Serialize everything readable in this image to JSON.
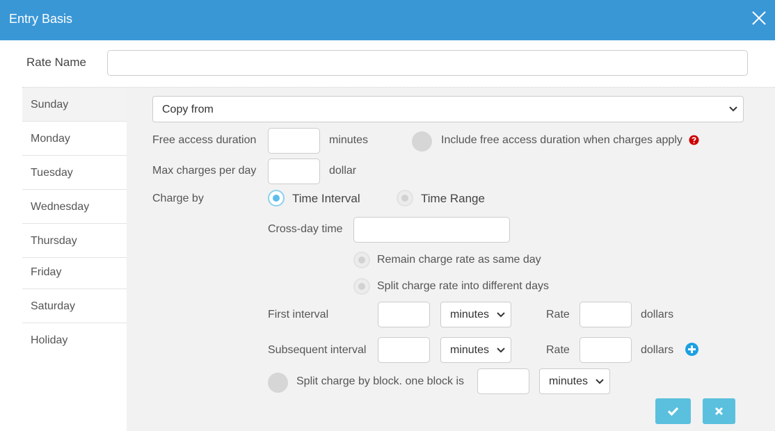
{
  "dialog": {
    "title": "Entry Basis"
  },
  "rate_name": {
    "label": "Rate Name",
    "value": ""
  },
  "days": [
    "Sunday",
    "Monday",
    "Tuesday",
    "Wednesday",
    "Thursday",
    "Friday",
    "Saturday",
    "Holiday"
  ],
  "copy_from": {
    "selected": "Copy from"
  },
  "free_access": {
    "label": "Free access duration",
    "unit": "minutes",
    "include_label": "Include free access duration when charges apply"
  },
  "max_charges": {
    "label": "Max charges per day",
    "unit": "dollar"
  },
  "charge_by": {
    "label": "Charge by",
    "options": [
      "Time Interval",
      "Time Range"
    ],
    "selected": "Time Interval"
  },
  "cross_day": {
    "label": "Cross-day time",
    "options": [
      "Remain charge rate as same day",
      "Split charge rate into different days"
    ]
  },
  "first_interval": {
    "label": "First interval",
    "unit": "minutes",
    "rate_label": "Rate",
    "rate_unit": "dollars"
  },
  "subsequent_interval": {
    "label": "Subsequent interval",
    "unit": "minutes",
    "rate_label": "Rate",
    "rate_unit": "dollars"
  },
  "split_block": {
    "label": "Split charge by block. one block is",
    "unit": "minutes"
  },
  "colors": {
    "header": "#3a97d6",
    "accent": "#5bc0de",
    "help": "#cc0000",
    "add": "#1aa1e1"
  }
}
